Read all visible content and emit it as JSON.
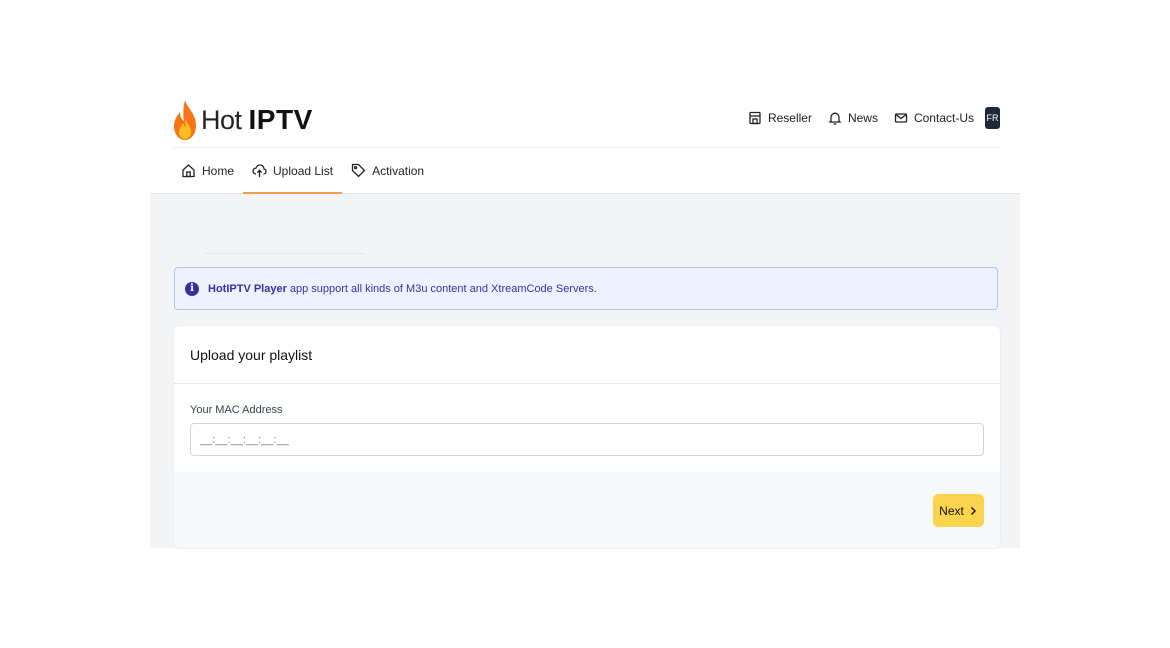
{
  "brand": {
    "name_light": "Hot",
    "name_bold": "IPTV",
    "flame_colors": [
      "#f97316",
      "#fbbf24"
    ]
  },
  "top_nav": {
    "items": [
      {
        "label": "Reseller",
        "icon": "store-icon"
      },
      {
        "label": "News",
        "icon": "bell-icon"
      },
      {
        "label": "Contact-Us",
        "icon": "mail-icon"
      }
    ],
    "language": "FR"
  },
  "tabs": [
    {
      "label": "Home",
      "icon": "home-icon",
      "active": false
    },
    {
      "label": "Upload List",
      "icon": "upload-cloud-icon",
      "active": true
    },
    {
      "label": "Activation",
      "icon": "tag-icon",
      "active": false
    }
  ],
  "alert": {
    "bold": "HotIPTV Player",
    "text": "app support all kinds of M3u content and XtreamCode Servers."
  },
  "form": {
    "title": "Upload your playlist",
    "mac_label": "Your MAC Address",
    "mac_placeholder": "__:__:__:__:__:__",
    "mac_value": "",
    "next_label": "Next"
  },
  "colors": {
    "accent": "#f5a34b",
    "button": "#fcd34d",
    "alert_bg": "#eef2ff",
    "alert_text": "#3730a3"
  }
}
